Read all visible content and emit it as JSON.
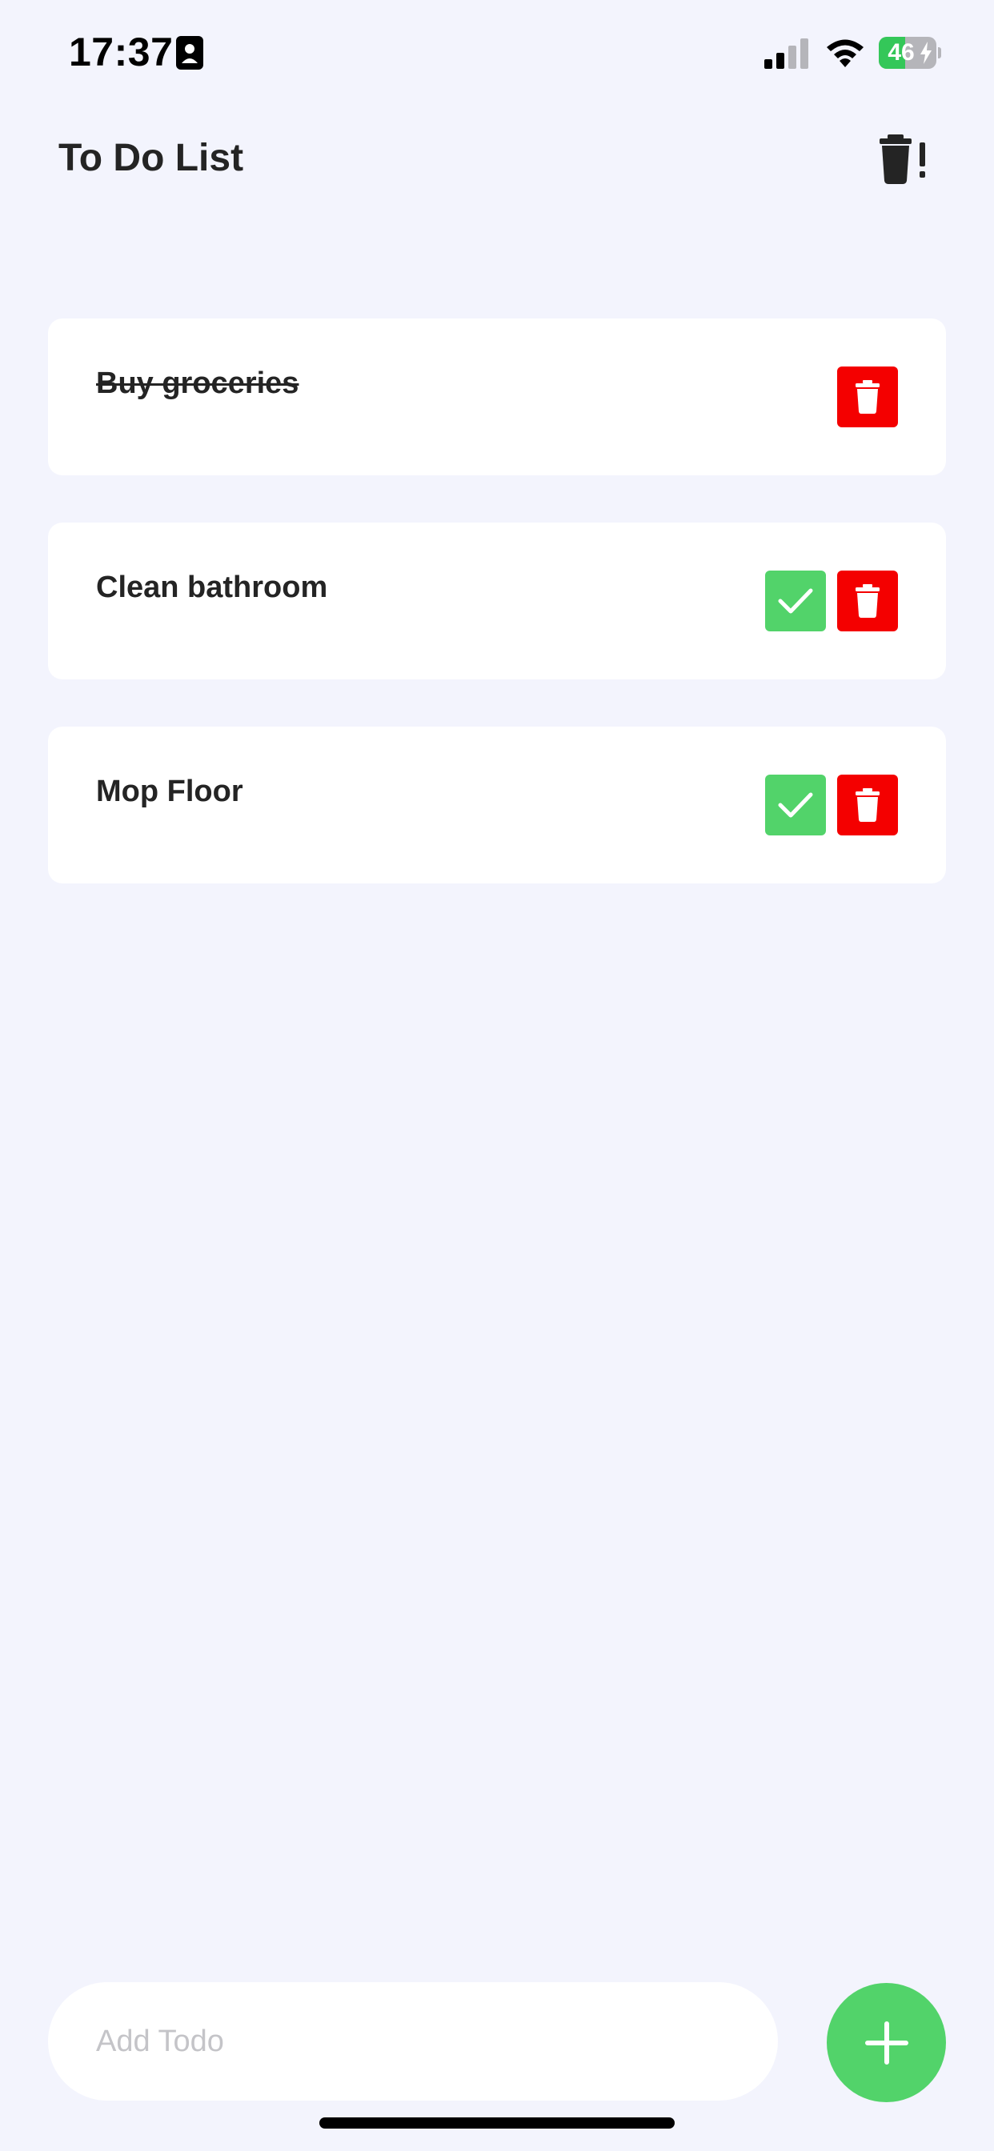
{
  "status_bar": {
    "time": "17:37",
    "battery_level": "46",
    "battery_fraction": 0.46,
    "icons": [
      "contact-card-icon",
      "cellular-signal-icon",
      "wifi-icon",
      "battery-charging-icon"
    ]
  },
  "header": {
    "title": "To Do List",
    "clear_all_icon": "trash-exclamation-icon"
  },
  "todos": [
    {
      "text": "Buy groceries",
      "completed": true
    },
    {
      "text": "Clean bathroom",
      "completed": false
    },
    {
      "text": "Mop Floor",
      "completed": false
    }
  ],
  "add_todo": {
    "placeholder": "Add Todo",
    "value": "",
    "button_icon": "plus-icon"
  },
  "colors": {
    "background": "#f3f4fd",
    "card": "#ffffff",
    "complete_green": "#52d36a",
    "delete_red": "#f40000",
    "text": "#242424",
    "placeholder": "#c4c4c8"
  }
}
